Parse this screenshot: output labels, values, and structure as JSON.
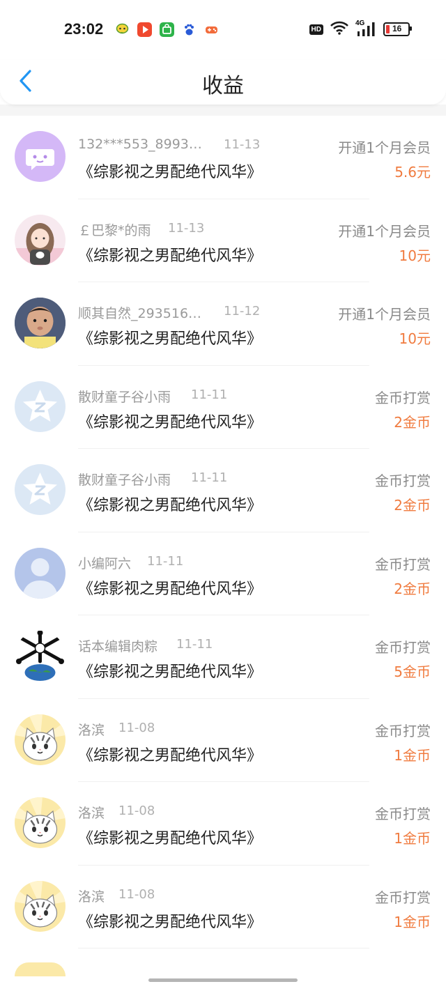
{
  "status_bar": {
    "time": "23:02",
    "hd_badge": "HD",
    "network": "4G",
    "battery_level": "16"
  },
  "header": {
    "title": "收益"
  },
  "rows": [
    {
      "name": "132***553_89930...",
      "date": "11-13",
      "book": "《综影视之男配绝代风华》",
      "type": "开通1个月会员",
      "amount": "5.6元",
      "avatar": "wechat-chat-avatar"
    },
    {
      "name": "￡巴黎*的雨",
      "date": "11-13",
      "book": "《综影视之男配绝代风华》",
      "type": "开通1个月会员",
      "amount": "10元",
      "avatar": "anime-girl-avatar"
    },
    {
      "name": "顺其自然_2935166...",
      "date": "11-12",
      "book": "《综影视之男配绝代风华》",
      "type": "开通1个月会员",
      "amount": "10元",
      "avatar": "baby-photo-avatar"
    },
    {
      "name": "散财童子谷小雨",
      "date": "11-11",
      "book": "《综影视之男配绝代风华》",
      "type": "金币打赏",
      "amount": "2金币",
      "avatar": "default-z-star-avatar"
    },
    {
      "name": "散财童子谷小雨",
      "date": "11-11",
      "book": "《综影视之男配绝代风华》",
      "type": "金币打赏",
      "amount": "2金币",
      "avatar": "default-z-star-avatar"
    },
    {
      "name": "小编阿六",
      "date": "11-11",
      "book": "《综影视之男配绝代风华》",
      "type": "金币打赏",
      "amount": "2金币",
      "avatar": "person-silhouette-avatar"
    },
    {
      "name": "话本编辑肉粽",
      "date": "11-11",
      "book": "《综影视之男配绝代风华》",
      "type": "金币打赏",
      "amount": "5金币",
      "avatar": "earth-bones-avatar"
    },
    {
      "name": "洛滨",
      "date": "11-08",
      "book": "《综影视之男配绝代风华》",
      "type": "金币打赏",
      "amount": "1金币",
      "avatar": "cat-avatar"
    },
    {
      "name": "洛滨",
      "date": "11-08",
      "book": "《综影视之男配绝代风华》",
      "type": "金币打赏",
      "amount": "1金币",
      "avatar": "cat-avatar"
    },
    {
      "name": "洛滨",
      "date": "11-08",
      "book": "《综影视之男配绝代风华》",
      "type": "金币打赏",
      "amount": "1金币",
      "avatar": "cat-avatar"
    }
  ],
  "colors": {
    "accent_blue": "#2196f3",
    "amount_orange": "#f07b3f",
    "name_gray": "#9a9a9a",
    "title_dark": "#222222"
  }
}
